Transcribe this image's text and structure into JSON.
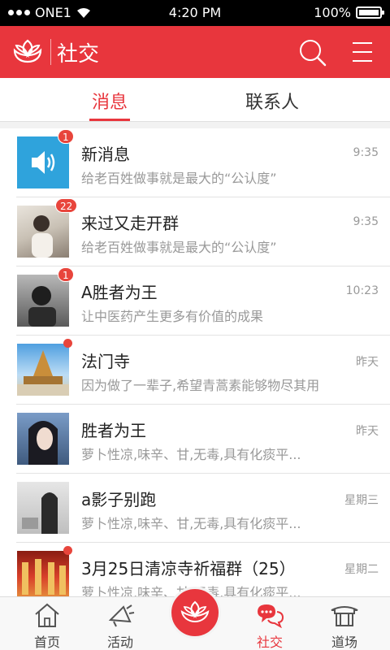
{
  "status_bar": {
    "carrier": "ONE1",
    "time": "4:20 PM",
    "battery": "100%",
    "battery_level": 1.0
  },
  "header": {
    "title": "社交",
    "search_icon": "search-icon",
    "menu_icon": "menu-icon",
    "accent": "#e8363d"
  },
  "tabs": [
    {
      "label": "消息",
      "active": true
    },
    {
      "label": "联系人",
      "active": false
    }
  ],
  "messages": [
    {
      "title": "新消息",
      "preview": "给老百姓做事就是最大的“公认度”",
      "time": "9:35",
      "badge": "1"
    },
    {
      "title": "来过又走开群",
      "preview": "给老百姓做事就是最大的“公认度”",
      "time": "9:35",
      "badge": "22"
    },
    {
      "title": "A胜者为王",
      "preview": "让中医药产生更多有价值的成果",
      "time": "10:23",
      "badge": "1"
    },
    {
      "title": "法门寺",
      "preview": "因为做了一辈子,希望青蒿素能够物尽其用",
      "time": "昨天",
      "badge": ""
    },
    {
      "title": "胜者为王",
      "preview": "萝卜性凉,味辛、甘,无毒,具有化痰平...",
      "time": "昨天",
      "badge": ""
    },
    {
      "title": "a影子别跑",
      "preview": "萝卜性凉,味辛、甘,无毒,具有化痰平...",
      "time": "星期三",
      "badge": ""
    },
    {
      "title": "3月25日清凉寺祈福群（25）",
      "preview": "萝卜性凉,味辛、甘,无毒,具有化痰平...",
      "time": "星期二",
      "badge": ""
    }
  ],
  "bottom_nav": [
    {
      "label": "首页",
      "icon": "home-icon"
    },
    {
      "label": "活动",
      "icon": "megaphone-icon"
    },
    {
      "label": "社交",
      "icon": "chat-icon",
      "active": true
    },
    {
      "label": "道场",
      "icon": "temple-icon"
    }
  ]
}
